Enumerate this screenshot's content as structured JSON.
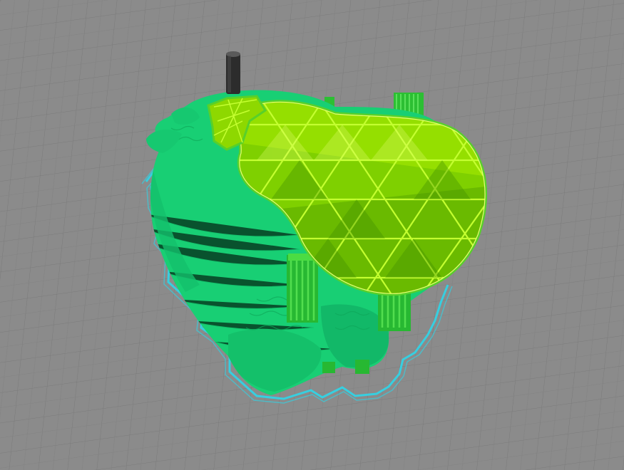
{
  "app": {
    "view": "slicer-layer-preview"
  },
  "colors": {
    "build_plate": "#8b8b8b",
    "grid_line": "#7e7e7e",
    "grid_major": "#707070",
    "model_shell": "#18cf74",
    "model_shell_dark": "#10a85b",
    "top_layer": "#58d02a",
    "infill_bright": "#a8f000",
    "infill_mid": "#7fd000",
    "infill_dark": "#5aa800",
    "support": "#3ad23e",
    "skirt": "#36cfe0",
    "nozzle": "#3a3a3a"
  },
  "icons": {
    "nozzle": "print-nozzle-icon"
  }
}
